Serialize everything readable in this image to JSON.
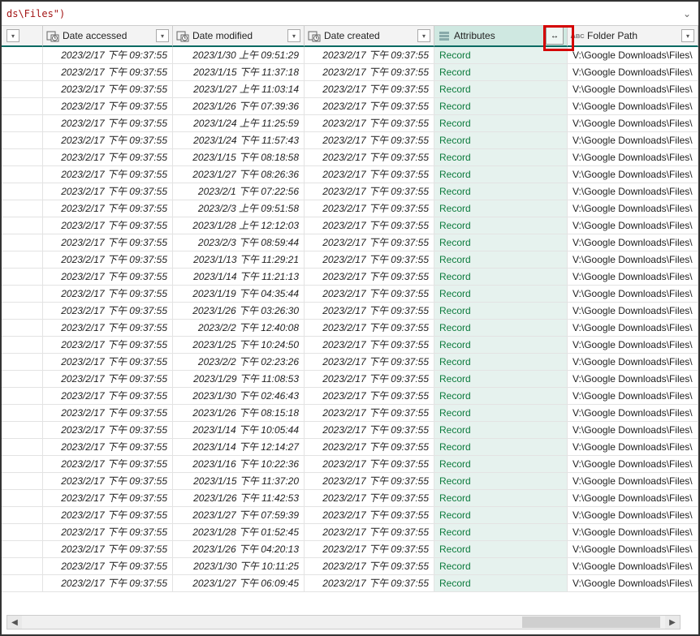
{
  "formula": "ds\\Files\")",
  "columns": {
    "stub_filter": "",
    "date_accessed": "Date accessed",
    "date_modified": "Date modified",
    "date_created": "Date created",
    "attributes": "Attributes",
    "folder_path": "Folder Path",
    "abc_prefix": "A"
  },
  "expand_glyph": "↔",
  "filter_glyph": "▾",
  "rows": [
    {
      "accessed": "2023/2/17 下午 09:37:55",
      "modified": "2023/1/30 上午 09:51:29",
      "created": "2023/2/17 下午 09:37:55",
      "attr": "Record",
      "path": "V:\\Google Downloads\\Files\\"
    },
    {
      "accessed": "2023/2/17 下午 09:37:55",
      "modified": "2023/1/15 下午 11:37:18",
      "created": "2023/2/17 下午 09:37:55",
      "attr": "Record",
      "path": "V:\\Google Downloads\\Files\\"
    },
    {
      "accessed": "2023/2/17 下午 09:37:55",
      "modified": "2023/1/27 上午 11:03:14",
      "created": "2023/2/17 下午 09:37:55",
      "attr": "Record",
      "path": "V:\\Google Downloads\\Files\\"
    },
    {
      "accessed": "2023/2/17 下午 09:37:55",
      "modified": "2023/1/26 下午 07:39:36",
      "created": "2023/2/17 下午 09:37:55",
      "attr": "Record",
      "path": "V:\\Google Downloads\\Files\\"
    },
    {
      "accessed": "2023/2/17 下午 09:37:55",
      "modified": "2023/1/24 上午 11:25:59",
      "created": "2023/2/17 下午 09:37:55",
      "attr": "Record",
      "path": "V:\\Google Downloads\\Files\\"
    },
    {
      "accessed": "2023/2/17 下午 09:37:55",
      "modified": "2023/1/24 下午 11:57:43",
      "created": "2023/2/17 下午 09:37:55",
      "attr": "Record",
      "path": "V:\\Google Downloads\\Files\\"
    },
    {
      "accessed": "2023/2/17 下午 09:37:55",
      "modified": "2023/1/15 下午 08:18:58",
      "created": "2023/2/17 下午 09:37:55",
      "attr": "Record",
      "path": "V:\\Google Downloads\\Files\\"
    },
    {
      "accessed": "2023/2/17 下午 09:37:55",
      "modified": "2023/1/27 下午 08:26:36",
      "created": "2023/2/17 下午 09:37:55",
      "attr": "Record",
      "path": "V:\\Google Downloads\\Files\\"
    },
    {
      "accessed": "2023/2/17 下午 09:37:55",
      "modified": "2023/2/1 下午 07:22:56",
      "created": "2023/2/17 下午 09:37:55",
      "attr": "Record",
      "path": "V:\\Google Downloads\\Files\\"
    },
    {
      "accessed": "2023/2/17 下午 09:37:55",
      "modified": "2023/2/3 上午 09:51:58",
      "created": "2023/2/17 下午 09:37:55",
      "attr": "Record",
      "path": "V:\\Google Downloads\\Files\\"
    },
    {
      "accessed": "2023/2/17 下午 09:37:55",
      "modified": "2023/1/28 上午 12:12:03",
      "created": "2023/2/17 下午 09:37:55",
      "attr": "Record",
      "path": "V:\\Google Downloads\\Files\\"
    },
    {
      "accessed": "2023/2/17 下午 09:37:55",
      "modified": "2023/2/3 下午 08:59:44",
      "created": "2023/2/17 下午 09:37:55",
      "attr": "Record",
      "path": "V:\\Google Downloads\\Files\\"
    },
    {
      "accessed": "2023/2/17 下午 09:37:55",
      "modified": "2023/1/13 下午 11:29:21",
      "created": "2023/2/17 下午 09:37:55",
      "attr": "Record",
      "path": "V:\\Google Downloads\\Files\\"
    },
    {
      "accessed": "2023/2/17 下午 09:37:55",
      "modified": "2023/1/14 下午 11:21:13",
      "created": "2023/2/17 下午 09:37:55",
      "attr": "Record",
      "path": "V:\\Google Downloads\\Files\\"
    },
    {
      "accessed": "2023/2/17 下午 09:37:55",
      "modified": "2023/1/19 下午 04:35:44",
      "created": "2023/2/17 下午 09:37:55",
      "attr": "Record",
      "path": "V:\\Google Downloads\\Files\\"
    },
    {
      "accessed": "2023/2/17 下午 09:37:55",
      "modified": "2023/1/26 下午 03:26:30",
      "created": "2023/2/17 下午 09:37:55",
      "attr": "Record",
      "path": "V:\\Google Downloads\\Files\\"
    },
    {
      "accessed": "2023/2/17 下午 09:37:55",
      "modified": "2023/2/2 下午 12:40:08",
      "created": "2023/2/17 下午 09:37:55",
      "attr": "Record",
      "path": "V:\\Google Downloads\\Files\\"
    },
    {
      "accessed": "2023/2/17 下午 09:37:55",
      "modified": "2023/1/25 下午 10:24:50",
      "created": "2023/2/17 下午 09:37:55",
      "attr": "Record",
      "path": "V:\\Google Downloads\\Files\\"
    },
    {
      "accessed": "2023/2/17 下午 09:37:55",
      "modified": "2023/2/2 下午 02:23:26",
      "created": "2023/2/17 下午 09:37:55",
      "attr": "Record",
      "path": "V:\\Google Downloads\\Files\\"
    },
    {
      "accessed": "2023/2/17 下午 09:37:55",
      "modified": "2023/1/29 下午 11:08:53",
      "created": "2023/2/17 下午 09:37:55",
      "attr": "Record",
      "path": "V:\\Google Downloads\\Files\\"
    },
    {
      "accessed": "2023/2/17 下午 09:37:55",
      "modified": "2023/1/30 下午 02:46:43",
      "created": "2023/2/17 下午 09:37:55",
      "attr": "Record",
      "path": "V:\\Google Downloads\\Files\\"
    },
    {
      "accessed": "2023/2/17 下午 09:37:55",
      "modified": "2023/1/26 下午 08:15:18",
      "created": "2023/2/17 下午 09:37:55",
      "attr": "Record",
      "path": "V:\\Google Downloads\\Files\\"
    },
    {
      "accessed": "2023/2/17 下午 09:37:55",
      "modified": "2023/1/14 下午 10:05:44",
      "created": "2023/2/17 下午 09:37:55",
      "attr": "Record",
      "path": "V:\\Google Downloads\\Files\\"
    },
    {
      "accessed": "2023/2/17 下午 09:37:55",
      "modified": "2023/1/14 下午 12:14:27",
      "created": "2023/2/17 下午 09:37:55",
      "attr": "Record",
      "path": "V:\\Google Downloads\\Files\\"
    },
    {
      "accessed": "2023/2/17 下午 09:37:55",
      "modified": "2023/1/16 下午 10:22:36",
      "created": "2023/2/17 下午 09:37:55",
      "attr": "Record",
      "path": "V:\\Google Downloads\\Files\\"
    },
    {
      "accessed": "2023/2/17 下午 09:37:55",
      "modified": "2023/1/15 下午 11:37:20",
      "created": "2023/2/17 下午 09:37:55",
      "attr": "Record",
      "path": "V:\\Google Downloads\\Files\\"
    },
    {
      "accessed": "2023/2/17 下午 09:37:55",
      "modified": "2023/1/26 下午 11:42:53",
      "created": "2023/2/17 下午 09:37:55",
      "attr": "Record",
      "path": "V:\\Google Downloads\\Files\\"
    },
    {
      "accessed": "2023/2/17 下午 09:37:55",
      "modified": "2023/1/27 下午 07:59:39",
      "created": "2023/2/17 下午 09:37:55",
      "attr": "Record",
      "path": "V:\\Google Downloads\\Files\\"
    },
    {
      "accessed": "2023/2/17 下午 09:37:55",
      "modified": "2023/1/28 下午 01:52:45",
      "created": "2023/2/17 下午 09:37:55",
      "attr": "Record",
      "path": "V:\\Google Downloads\\Files\\"
    },
    {
      "accessed": "2023/2/17 下午 09:37:55",
      "modified": "2023/1/26 下午 04:20:13",
      "created": "2023/2/17 下午 09:37:55",
      "attr": "Record",
      "path": "V:\\Google Downloads\\Files\\"
    },
    {
      "accessed": "2023/2/17 下午 09:37:55",
      "modified": "2023/1/30 下午 10:11:25",
      "created": "2023/2/17 下午 09:37:55",
      "attr": "Record",
      "path": "V:\\Google Downloads\\Files\\"
    },
    {
      "accessed": "2023/2/17 下午 09:37:55",
      "modified": "2023/1/27 下午 06:09:45",
      "created": "2023/2/17 下午 09:37:55",
      "attr": "Record",
      "path": "V:\\Google Downloads\\Files\\"
    }
  ]
}
